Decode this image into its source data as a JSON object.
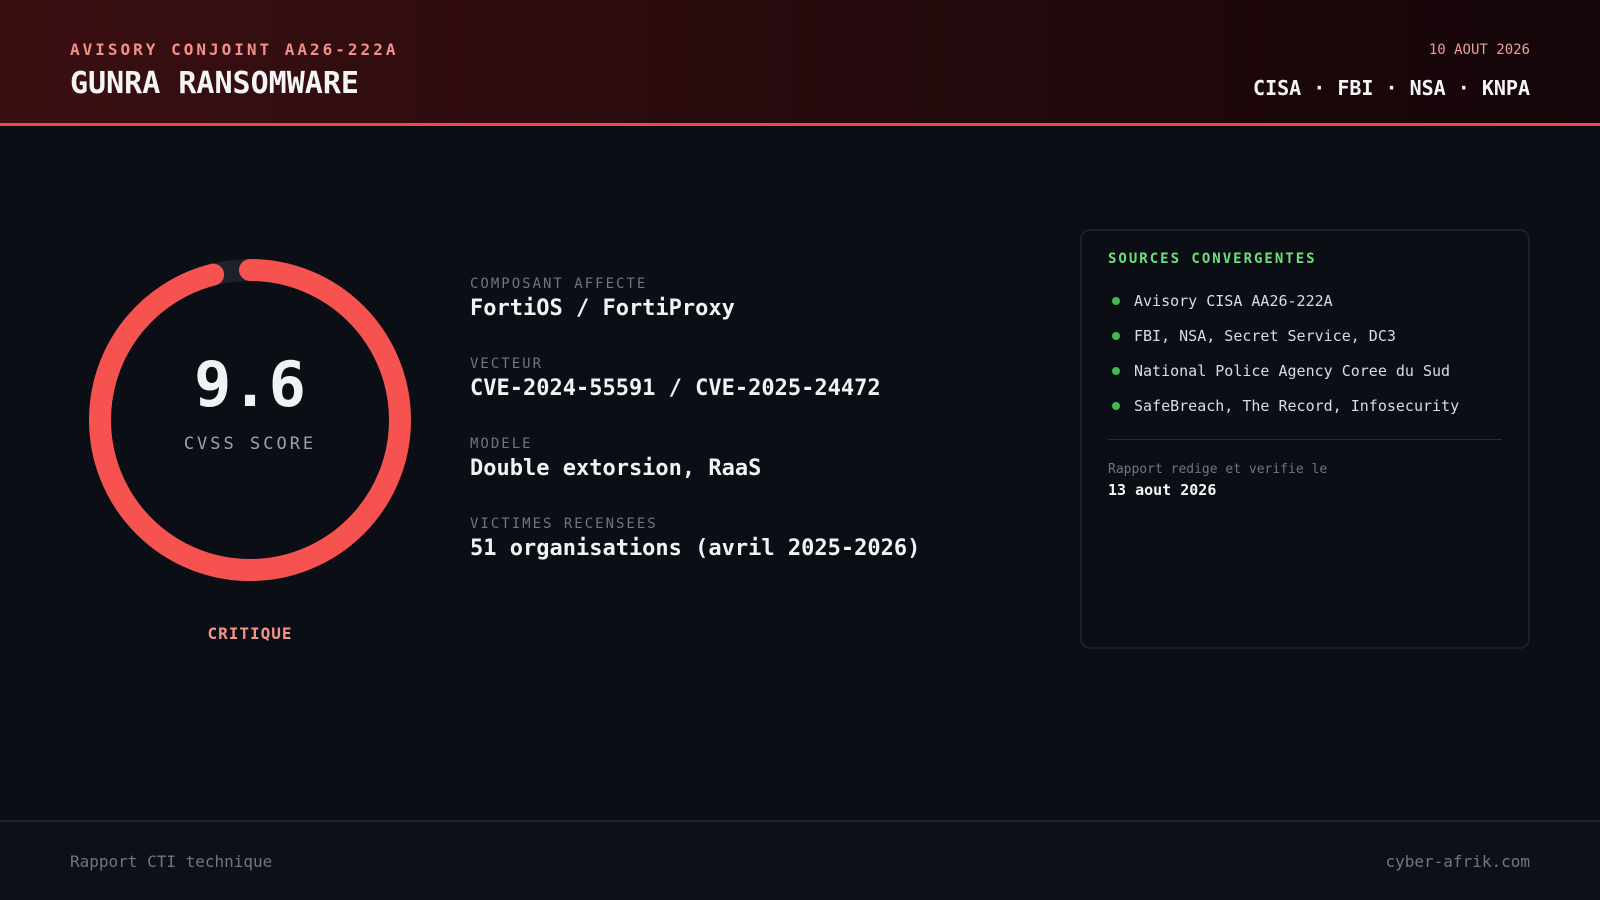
{
  "header": {
    "kicker": "AVISORY CONJOINT AA26-222A",
    "title": "GUNRA RANSOMWARE",
    "date": "10 AOUT 2026",
    "agencies": "CISA · FBI · NSA · KNPA"
  },
  "score": {
    "value": "9.6",
    "max": 10,
    "label": "CVSS SCORE",
    "severity": "CRITIQUE",
    "colors": {
      "arc": "#f65350",
      "track": "#1b222b",
      "severity": "#f4938a"
    }
  },
  "fields": [
    {
      "label": "COMPOSANT AFFECTE",
      "value": "FortiOS / FortiProxy"
    },
    {
      "label": "VECTEUR",
      "value": "CVE-2024-55591 / CVE-2025-24472"
    },
    {
      "label": "MODELE",
      "value": "Double extorsion, RaaS"
    },
    {
      "label": "VICTIMES RECENSEES",
      "value": "51 organisations (avril 2025-2026)"
    }
  ],
  "sources": {
    "title": "SOURCES CONVERGENTES",
    "items": [
      "Avisory CISA AA26-222A",
      "FBI, NSA, Secret Service, DC3",
      "National Police Agency Coree du Sud",
      "SafeBreach, The Record, Infosecurity"
    ],
    "report_label": "Rapport redige et verifie le",
    "report_date": "13 aout 2026",
    "accent_color": "#6ee07a"
  },
  "footer": {
    "left": "Rapport CTI technique",
    "right": "cyber-afrik.com"
  }
}
